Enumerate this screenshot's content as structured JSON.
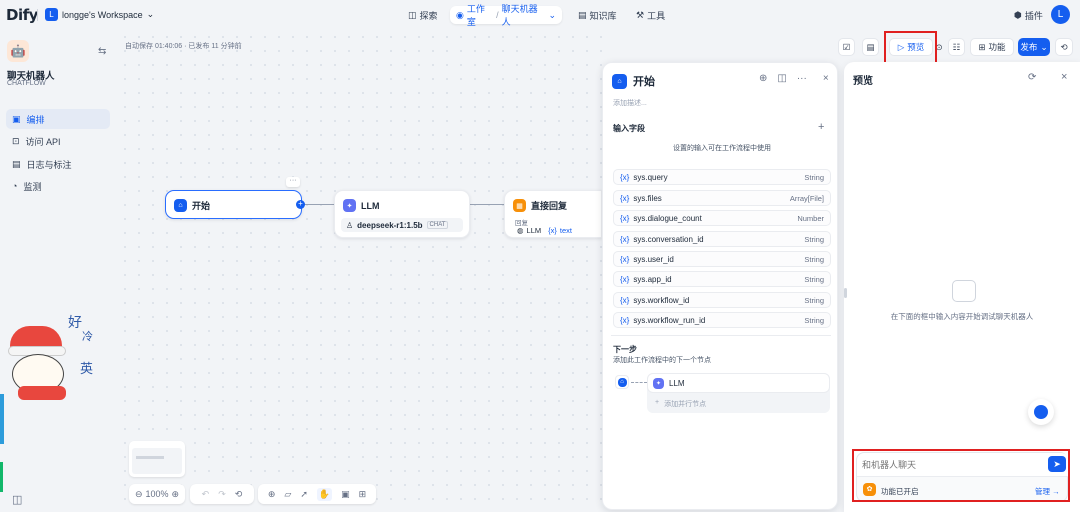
{
  "topbar": {
    "logo": "Dify",
    "workspace_initial": "L",
    "workspace_name": "longge's Workspace",
    "nav": [
      "探索",
      "工作室",
      "聊天机器人",
      "知识库",
      "工具"
    ],
    "plugins": "插件",
    "user_initial": "L"
  },
  "sidebar": {
    "app_name": "聊天机器人",
    "app_type": "CHATFLOW",
    "items": [
      "编排",
      "访问 API",
      "日志与标注",
      "监测"
    ]
  },
  "autosave": "自动保存 01:40:06 · 已发布 11 分钟前",
  "toolbar": {
    "preview": "预览",
    "features": "功能",
    "publish": "发布"
  },
  "nodes": {
    "start": "开始",
    "llm": "LLM",
    "llm_model": "deepseek-r1:1.5b",
    "llm_mode": "CHAT",
    "answer": "直接回复",
    "answer_label": "回复",
    "answer_ref_node": "LLM",
    "answer_ref_var": "text",
    "more": "···"
  },
  "zoom": "100%",
  "panel": {
    "title": "开始",
    "description_placeholder": "添加描述...",
    "input_section": "输入字段",
    "input_hint": "设置的输入可在工作流程中使用",
    "variables": [
      {
        "name": "sys.query",
        "type": "String"
      },
      {
        "name": "sys.files",
        "type": "Array[File]"
      },
      {
        "name": "sys.dialogue_count",
        "type": "Number"
      },
      {
        "name": "sys.conversation_id",
        "type": "String"
      },
      {
        "name": "sys.user_id",
        "type": "String"
      },
      {
        "name": "sys.app_id",
        "type": "String"
      },
      {
        "name": "sys.workflow_id",
        "type": "String"
      },
      {
        "name": "sys.workflow_run_id",
        "type": "String"
      }
    ],
    "next_step": "下一步",
    "next_hint": "添加此工作流程中的下一个节点",
    "next_node": "LLM",
    "add_parallel": "添加并行节点"
  },
  "preview_panel": {
    "title": "预览",
    "empty_hint": "在下面的框中输入内容开始调试聊天机器人",
    "input_placeholder": "和机器人聊天",
    "features_enabled": "功能已开启",
    "manage": "管理 →"
  },
  "sticker": {
    "chars": [
      "好",
      "冷",
      "英"
    ]
  },
  "colors": {
    "accent": "#155eef",
    "highlight": "#e02020",
    "llm": "#6172f3",
    "answer": "#f79009"
  }
}
